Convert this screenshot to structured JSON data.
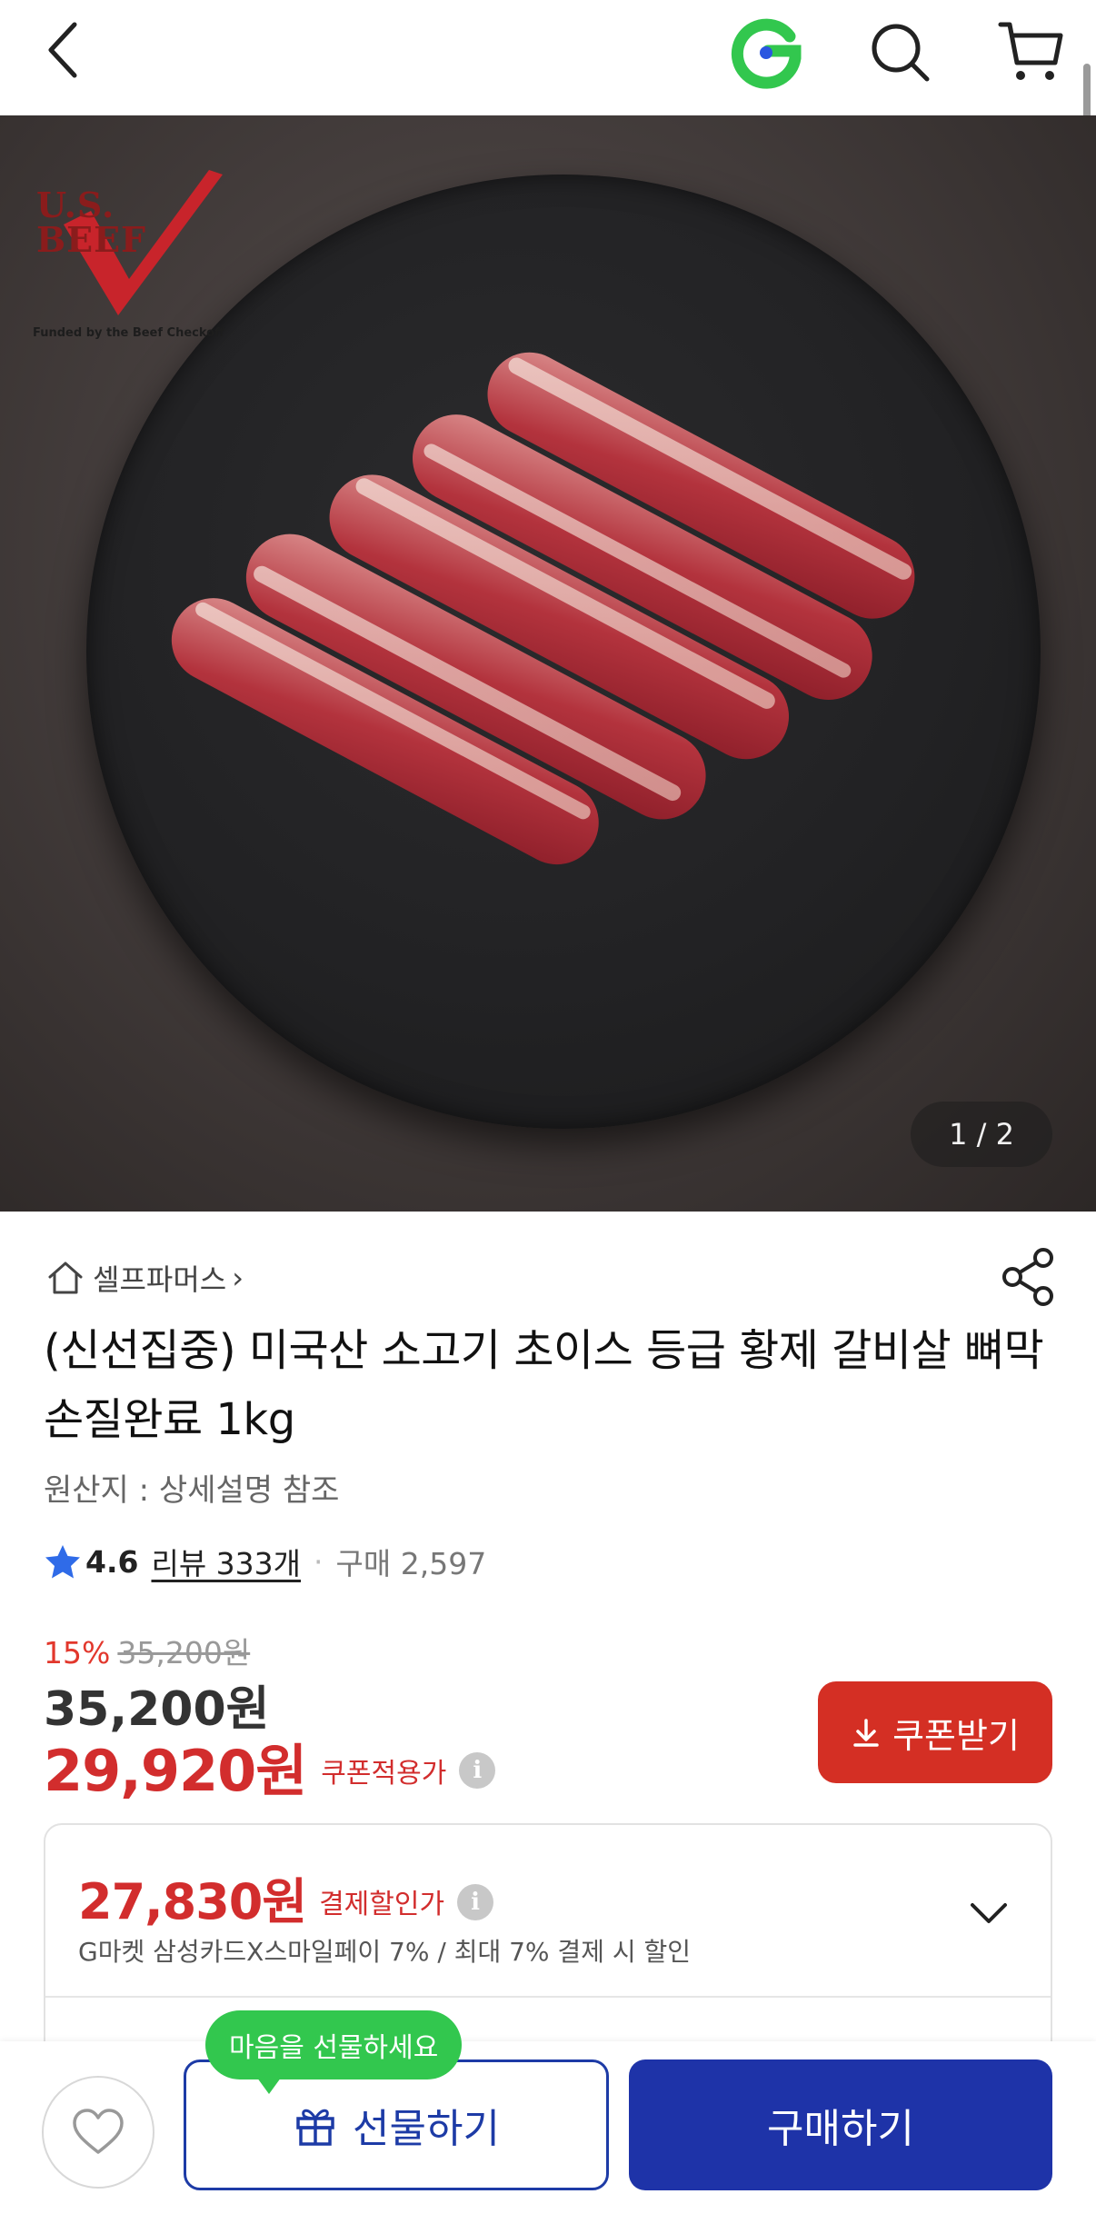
{
  "header": {
    "back_icon": "chevron-left-icon",
    "logo_icon": "gmarket-g-logo",
    "search_icon": "search-icon",
    "cart_icon": "cart-icon"
  },
  "hero": {
    "badge_title": "U.S.\nBEEF",
    "badge_funded": "Funded by the Beef Checkoff",
    "counter": "1 / 2"
  },
  "seller": {
    "name": "셀프파머스",
    "chevron": "›"
  },
  "product": {
    "title": "(신선집중) 미국산 소고기 초이스 등급 황제 갈비살 뼈막손질완료 1kg",
    "origin": "원산지 : 상세설명 참조",
    "rating": "4.6",
    "review": "리뷰 333개",
    "separator": "·",
    "purchases": "구매 2,597"
  },
  "pricing": {
    "discount_pct": "15%",
    "original_price": "35,200원",
    "price": "35,200원",
    "coupon_price": "29,920원",
    "coupon_label": "쿠폰적용가",
    "coupon_button": "쿠폰받기"
  },
  "payment_card": {
    "price": "27,830원",
    "label": "결제할인가",
    "description": "G마켓 삼성카드X스마일페이 7% / 최대 7% 결제 시 할인"
  },
  "bottom": {
    "tooltip": "마음을 선물하세요",
    "gift_label": "선물하기",
    "buy_label": "구매하기"
  },
  "colors": {
    "accent_red": "#d22d2d",
    "brand_blue": "#1e33a8",
    "gmarket_green": "#32c74e"
  }
}
